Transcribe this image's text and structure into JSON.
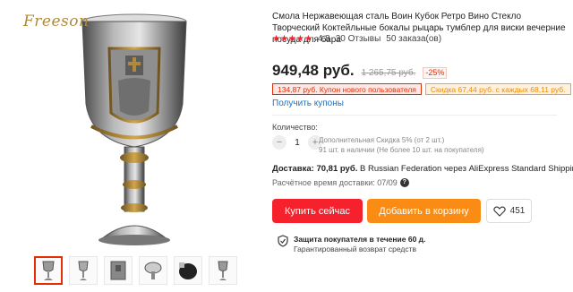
{
  "gallery": {
    "brand_watermark": "Freeson",
    "thumbnails": [
      "thumb-1",
      "thumb-2",
      "thumb-3",
      "thumb-4",
      "thumb-5",
      "thumb-6"
    ],
    "active_index": 0
  },
  "product": {
    "title": "Смола Нержавеющая сталь Воин Кубок Ретро Вино Стекло Творческий Коктейльные бокалы рыцарь тумблер для виски вечерние посуда для бара",
    "rating_value": "4.8",
    "stars": "★★★★★",
    "reviews": "20 Отзывы",
    "orders": "50 заказа(ов)",
    "price": "949,48 руб.",
    "old_price": "1 265,75 руб.",
    "discount": "-25%",
    "coupon_new_user": "134,87 руб. Купон нового пользователя",
    "coupon_store": "Скидка 67,44 руб. с каждых 68,11 руб.",
    "get_coupons": "Получить купоны"
  },
  "quantity": {
    "label": "Количество:",
    "value": "1",
    "minus": "−",
    "plus": "+",
    "note1": "Дополнительная Скидка 5% (от 2 шт.)",
    "note2": "91 шт. в наличии (Не более 10 шт. на покупателя)"
  },
  "shipping": {
    "label": "Доставка: 70,81 руб.",
    "details": "В Russian Federation через AliExpress Standard Shipping",
    "estimate": "Расчётное время доставки: 07/09",
    "help_icon_glyph": "?"
  },
  "actions": {
    "buy_now": "Купить сейчас",
    "add_to_cart": "Добавить в корзину",
    "wishlist_count": "451"
  },
  "protection": {
    "title": "Защита покупателя в течение 60 д.",
    "subtitle": "Гарантированный возврат средств"
  },
  "colors": {
    "accent_red": "#f5222d",
    "accent_orange": "#fa8c16",
    "link_blue": "#1a73c8"
  }
}
